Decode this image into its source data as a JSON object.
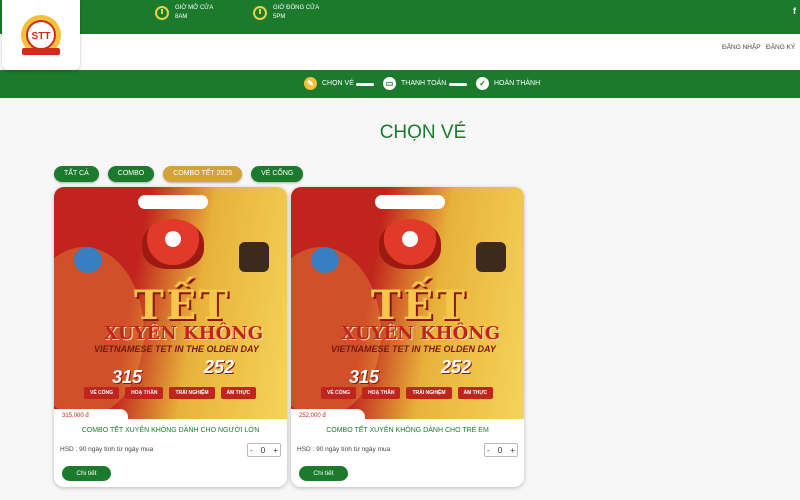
{
  "header": {
    "open_hours_label": "GIỜ MỞ CỬA",
    "open_hours_value": "8AM",
    "close_hours_label": "GIỜ ĐÓNG CỬA",
    "close_hours_value": "5PM",
    "facebook": "f",
    "login": "ĐĂNG NHẬP",
    "register": "ĐĂNG KÝ"
  },
  "steps": [
    {
      "label": "CHỌN VÉ",
      "icon": "ticket-icon"
    },
    {
      "label": "THANH TOÁN",
      "icon": "payment-icon"
    },
    {
      "label": "HOÀN THÀNH",
      "icon": "check-icon"
    }
  ],
  "page": {
    "title": "CHỌN VÉ"
  },
  "filters": [
    {
      "label": "TẤT CẢ",
      "active": false
    },
    {
      "label": "COMBO",
      "active": false
    },
    {
      "label": "COMBO TẾT 2025",
      "active": true
    },
    {
      "label": "VÉ CỔNG",
      "active": false
    }
  ],
  "cards": [
    {
      "price": "315,000 đ",
      "title": "COMBO TẾT XUYÊN KHÔNG DÀNH CHO NGƯỜI LỚN",
      "hsd": "HSD : 90 ngày tính từ ngày mua",
      "quantity": "0",
      "detail_label": "Chi tiết",
      "poster": {
        "title": "TẾT",
        "subtitle": "XUYÊN KHÔNG",
        "tagline": "VIETNAMESE TET IN THE OLDEN DAY",
        "price_a": "315",
        "price_b": "252"
      }
    },
    {
      "price": "252,000 đ",
      "title": "COMBO TẾT XUYÊN KHÔNG DÀNH CHO TRẺ EM",
      "hsd": "HSD : 90 ngày tính từ ngày mua",
      "quantity": "0",
      "detail_label": "Chi tiết",
      "poster": {
        "title": "TẾT",
        "subtitle": "XUYÊN KHÔNG",
        "tagline": "VIETNAMESE TET IN THE OLDEN DAY",
        "price_a": "315",
        "price_b": "252"
      }
    }
  ],
  "stepper": {
    "minus": "-",
    "plus": "+"
  },
  "poster_tags": [
    "VÉ CỔNG",
    "HOẠ THẦN",
    "TRẢI NGHIỆM",
    "ẨM THỰC"
  ],
  "colors": {
    "primary": "#1c7a2c",
    "accent": "#d4a23a",
    "poster_red": "#c0241c"
  }
}
